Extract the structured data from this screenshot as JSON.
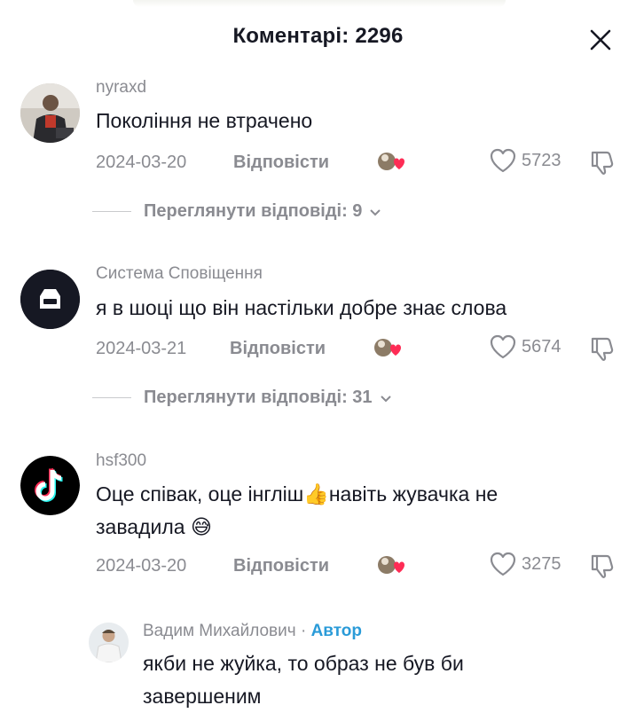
{
  "header": {
    "title": "Коментарі: 2296"
  },
  "comments": [
    {
      "username": "nyraxd",
      "text": "Покоління не втрачено",
      "date": "2024-03-20",
      "reply_label": "Відповісти",
      "likes": "5723",
      "view_replies": "Переглянути відповіді: 9"
    },
    {
      "username": "Система Сповіщення",
      "text": "я в шоці що він настільки добре знає слова",
      "date": "2024-03-21",
      "reply_label": "Відповісти",
      "likes": "5674",
      "view_replies": "Переглянути відповіді: 31"
    },
    {
      "username": "hsf300",
      "text_line1": "Оце співак, оце інгліш👍навіть жувачка не",
      "text_line2": "завадила 😅",
      "date": "2024-03-20",
      "reply_label": "Відповісти",
      "likes": "3275"
    }
  ],
  "reply": {
    "username": "Вадим Михайлович",
    "separator": " · ",
    "badge": "Автор",
    "text_line1": "якби не жуйка, то образ не був би",
    "text_line2": "завершеним"
  },
  "colors": {
    "text": "#161823",
    "muted": "#8a8b91",
    "author": "#2a9bd8",
    "like_red": "#fe2c55"
  }
}
